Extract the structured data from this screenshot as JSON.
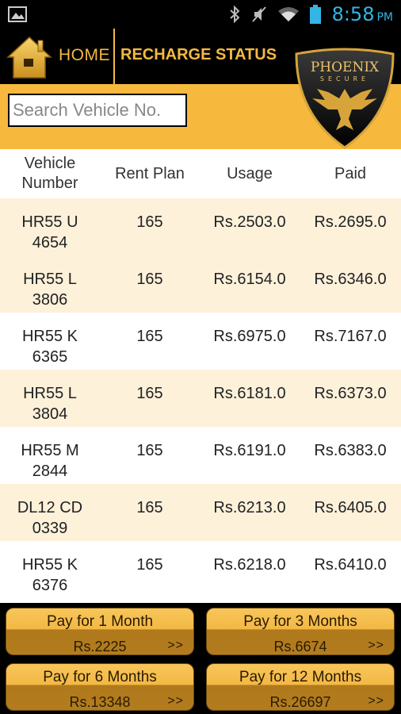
{
  "status_bar": {
    "time": "8:58",
    "ampm": "PM"
  },
  "header": {
    "home_label": "HOME",
    "title": "RECHARGE STATUS"
  },
  "logo": {
    "line1": "PHOENIX",
    "line2": "SECURE"
  },
  "search": {
    "placeholder": "Search Vehicle No."
  },
  "table": {
    "headers": [
      "Vehicle\nNumber",
      "Rent Plan",
      "Usage",
      "Paid"
    ],
    "rows": [
      {
        "vehicle": "HR55 U\n4654",
        "plan": "165",
        "usage": "Rs.2503.0",
        "paid": "Rs.2695.0"
      },
      {
        "vehicle": "HR55 L\n3806",
        "plan": "165",
        "usage": "Rs.6154.0",
        "paid": "Rs.6346.0"
      },
      {
        "vehicle": "HR55 K\n6365",
        "plan": "165",
        "usage": "Rs.6975.0",
        "paid": "Rs.7167.0"
      },
      {
        "vehicle": "HR55 L\n3804",
        "plan": "165",
        "usage": "Rs.6181.0",
        "paid": "Rs.6373.0"
      },
      {
        "vehicle": "HR55 M\n2844",
        "plan": "165",
        "usage": "Rs.6191.0",
        "paid": "Rs.6383.0"
      },
      {
        "vehicle": "DL12 CD\n0339",
        "plan": "165",
        "usage": "Rs.6213.0",
        "paid": "Rs.6405.0"
      },
      {
        "vehicle": "HR55 K\n6376",
        "plan": "165",
        "usage": "Rs.6218.0",
        "paid": "Rs.6410.0"
      }
    ]
  },
  "pay_buttons": [
    {
      "label": "Pay for 1 Month",
      "price": "Rs.2225",
      "chevron": ">>"
    },
    {
      "label": "Pay for 3 Months",
      "price": "Rs.6674",
      "chevron": ">>"
    },
    {
      "label": "Pay for 6 Months",
      "price": "Rs.13348",
      "chevron": ">>"
    },
    {
      "label": "Pay for 12 Months",
      "price": "Rs.26697",
      "chevron": ">>"
    }
  ],
  "colors": {
    "accent": "#f4b942",
    "band": "#f6b93e",
    "row_alt": "#fdf1da",
    "clock": "#33b5e5"
  }
}
